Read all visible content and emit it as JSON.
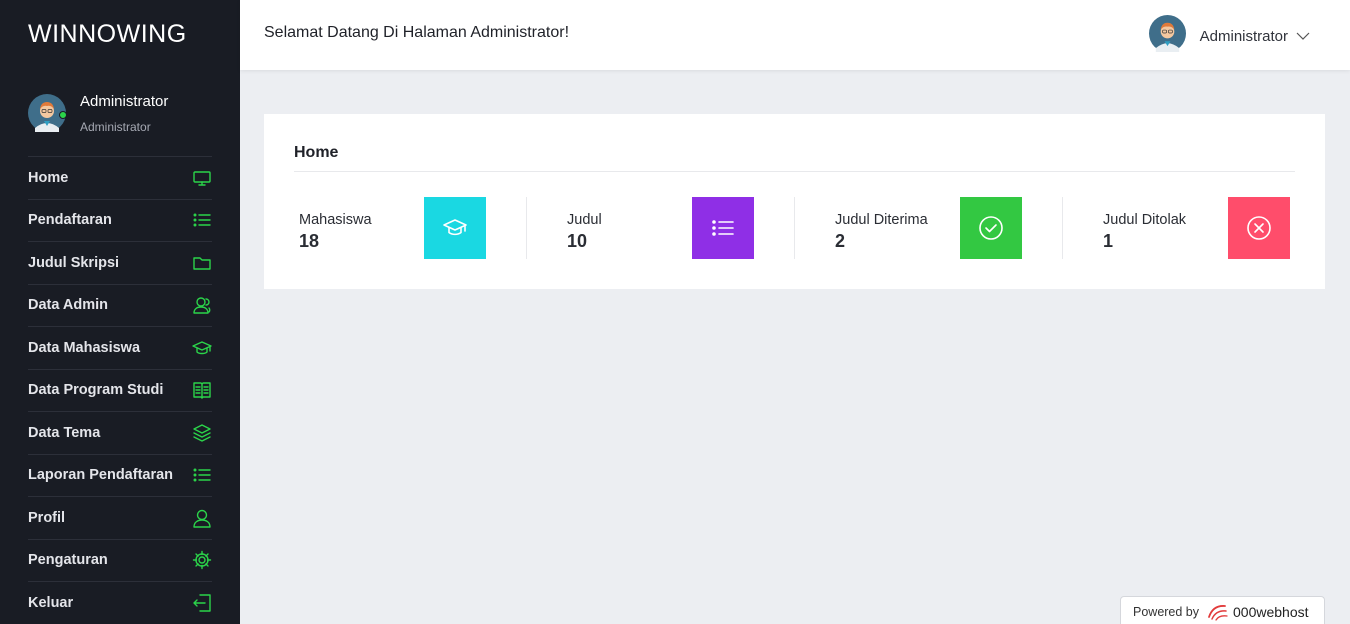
{
  "app": {
    "brand": "WINNOWING"
  },
  "sidebar": {
    "profile": {
      "name": "Administrator",
      "role": "Administrator"
    },
    "items": [
      {
        "label": "Home",
        "icon": "monitor-icon"
      },
      {
        "label": "Pendaftaran",
        "icon": "list-icon"
      },
      {
        "label": "Judul Skripsi",
        "icon": "folder-icon"
      },
      {
        "label": "Data Admin",
        "icon": "users-icon"
      },
      {
        "label": "Data Mahasiswa",
        "icon": "graduation-cap-icon"
      },
      {
        "label": "Data Program Studi",
        "icon": "book-icon"
      },
      {
        "label": "Data Tema",
        "icon": "layers-icon"
      },
      {
        "label": "Laporan Pendaftaran",
        "icon": "list-icon"
      },
      {
        "label": "Profil",
        "icon": "user-icon"
      },
      {
        "label": "Pengaturan",
        "icon": "gear-icon"
      },
      {
        "label": "Keluar",
        "icon": "logout-icon"
      }
    ]
  },
  "topbar": {
    "welcome": "Selamat Datang Di Halaman Administrator!",
    "user_name": "Administrator"
  },
  "main": {
    "card_title": "Home",
    "stats": [
      {
        "label": "Mahasiswa",
        "value": "18",
        "color": "#1ad8e2",
        "icon": "graduation-cap-icon"
      },
      {
        "label": "Judul",
        "value": "10",
        "color": "#8f2fe6",
        "icon": "list-icon"
      },
      {
        "label": "Judul Diterima",
        "value": "2",
        "color": "#33c842",
        "icon": "check-circle-icon"
      },
      {
        "label": "Judul Ditolak",
        "value": "1",
        "color": "#ff4d6b",
        "icon": "x-circle-icon"
      }
    ]
  },
  "footer": {
    "powered_text": "Powered by",
    "host_brand": "000webhost"
  },
  "colors": {
    "sidebar_bg": "#191c24",
    "accent_green": "#2bd44a",
    "page_bg": "#eceef2"
  }
}
